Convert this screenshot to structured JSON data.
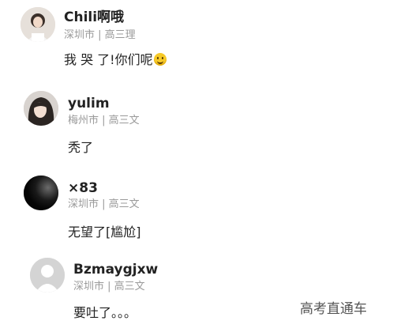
{
  "comments": [
    {
      "username": "Chili啊哦",
      "location": "深圳市",
      "school": "高三理",
      "text": "我 哭 了!你们呢",
      "emoji": "smile-emoji"
    },
    {
      "username": "yulim",
      "location": "梅州市",
      "school": "高三文",
      "text": "秃了"
    },
    {
      "username": "×83",
      "location": "深圳市",
      "school": "高三文",
      "text": "无望了[尴尬]"
    },
    {
      "username": "Bzmaygjxw",
      "location": "深圳市",
      "school": "高三文",
      "text": "要吐了。。。"
    }
  ],
  "separator": " | ",
  "watermark": "高考直通车"
}
